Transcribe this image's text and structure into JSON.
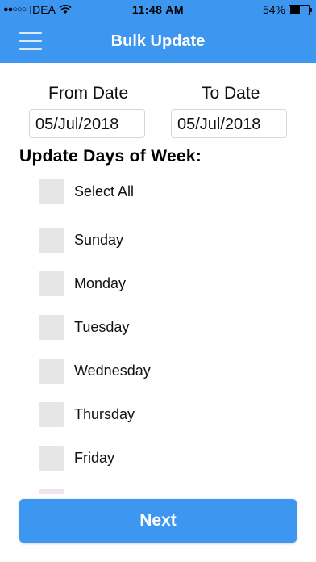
{
  "status_bar": {
    "signal": "●●○○○",
    "carrier": "IDEA",
    "time": "11:48 AM",
    "battery_text": "54%",
    "battery_level": 0.54,
    "icons": [
      "signal-dots-icon",
      "wifi-icon",
      "battery-icon"
    ]
  },
  "header": {
    "title": "Bulk Update",
    "menu_icon": "hamburger-menu-icon"
  },
  "date_range": {
    "from_label": "From Date",
    "from_value": "05/Jul/2018",
    "to_label": "To Date",
    "to_value": "05/Jul/2018"
  },
  "days_section": {
    "title": "Update Days of Week:",
    "select_all_label": "Select All",
    "days": [
      {
        "label": "Sunday",
        "checked": false
      },
      {
        "label": "Monday",
        "checked": false
      },
      {
        "label": "Tuesday",
        "checked": false
      },
      {
        "label": "Wednesday",
        "checked": false
      },
      {
        "label": "Thursday",
        "checked": false
      },
      {
        "label": "Friday",
        "checked": false
      }
    ]
  },
  "footer": {
    "next_label": "Next"
  },
  "colors": {
    "accent": "#3d97f1",
    "checkbox": "#e6e6e6",
    "text": "#111111"
  }
}
